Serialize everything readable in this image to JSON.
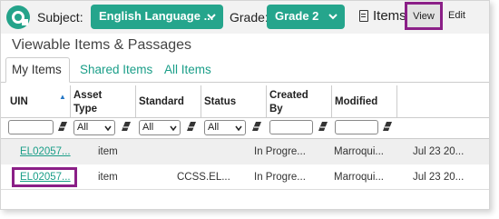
{
  "toolbar": {
    "subject_label": "Subject:",
    "subject_value": "English Language ...",
    "grade_label": "Grade:",
    "grade_value": "Grade 2",
    "items_label": "Items",
    "view_label": "View",
    "edit_label": "Edit"
  },
  "panel": {
    "title": "Viewable Items & Passages",
    "tabs": [
      {
        "label": "My Items",
        "active": true
      },
      {
        "label": "Shared Items",
        "active": false
      },
      {
        "label": "All Items",
        "active": false
      }
    ]
  },
  "table": {
    "columns": [
      "UIN",
      "Asset Type",
      "Standard",
      "Status",
      "Created By",
      "Modified"
    ],
    "filters": {
      "asset_type": "All",
      "standard": "All",
      "status": "All"
    },
    "rows": [
      {
        "uin": "EL02057...",
        "type": "item",
        "standard": "",
        "status": "In Progre...",
        "created_by": "Marroqui...",
        "modified": "Jul 23 20..."
      },
      {
        "uin": "EL02057...",
        "type": "item",
        "standard": "CCSS.EL...",
        "status": "In Progre...",
        "created_by": "Marroqui...",
        "modified": "Jul 23 20..."
      }
    ]
  },
  "colors": {
    "accent": "#25a58c",
    "highlight": "#8b1f87",
    "link": "#1a9e88"
  }
}
